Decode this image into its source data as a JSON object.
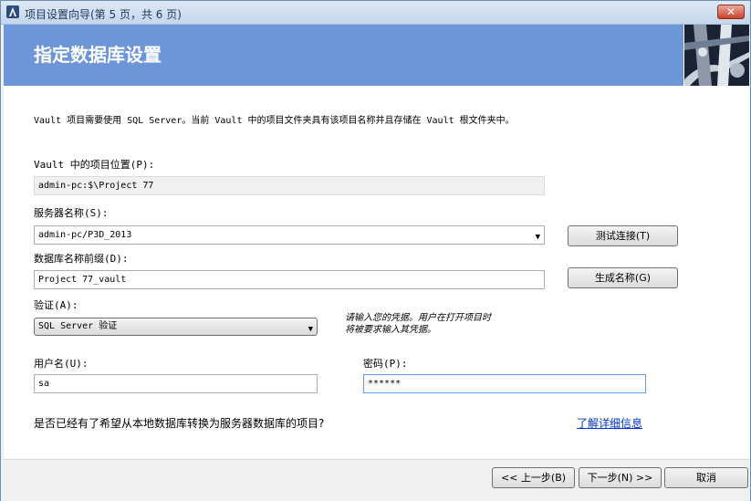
{
  "window": {
    "title": "项目设置向导(第 5 页，共 6 页)",
    "close_label": "✕"
  },
  "banner": {
    "title": "指定数据库设置"
  },
  "description": "Vault 项目需要使用 SQL Server。当前 Vault 中的项目文件夹具有该项目名称并且存储在 Vault 根文件夹中。",
  "location": {
    "label": "Vault 中的项目位置(P):",
    "value": "admin-pc:$\\Project 77"
  },
  "server": {
    "label": "服务器名称(S):",
    "value": "admin-pc/P3D_2013",
    "test_button": "测试连接(T)"
  },
  "db_prefix": {
    "label": "数据库名称前缀(D):",
    "value": "Project 77_vault",
    "generate_button": "生成名称(G)"
  },
  "auth": {
    "label": "验证(A):",
    "value": "SQL Server 验证",
    "hint_line1": "请输入您的凭据。用户在打开项目时",
    "hint_line2": "将被要求输入其凭据。"
  },
  "username": {
    "label": "用户名(U):",
    "value": "sa"
  },
  "password": {
    "label": "密码(P):",
    "value": "******"
  },
  "convert": {
    "question": "是否已经有了希望从本地数据库转换为服务器数据库的项目?",
    "link": "了解详细信息"
  },
  "footer": {
    "back": "<< 上一步(B)",
    "next": "下一步(N) >>",
    "cancel": "取消"
  }
}
